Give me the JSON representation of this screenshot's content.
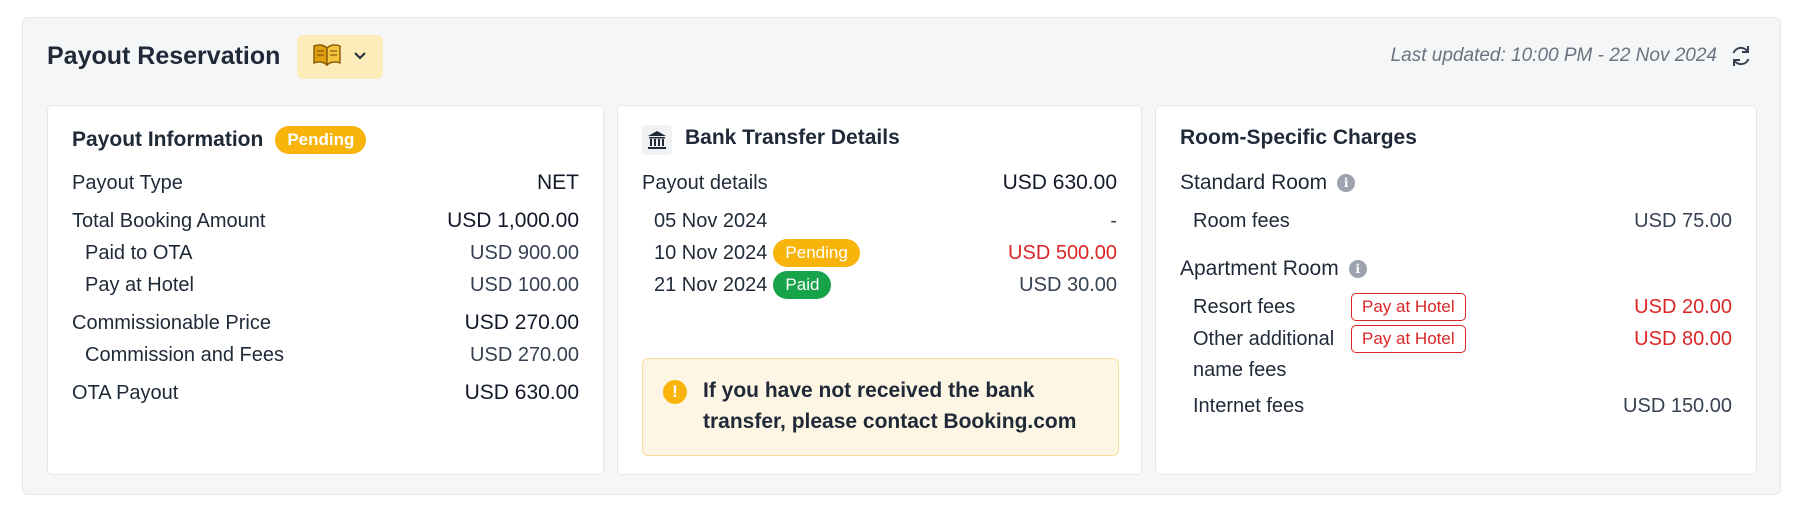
{
  "header": {
    "title": "Payout Reservation",
    "book_icon": "open-book-icon",
    "dropdown_icon": "chevron-down-icon",
    "last_updated": "Last updated: 10:00 PM - 22 Nov 2024",
    "refresh_icon": "refresh-icon"
  },
  "payout_info": {
    "title": "Payout Information",
    "status": "Pending",
    "rows": [
      {
        "label": "Payout Type",
        "value": "NET"
      },
      {
        "label": "Total Booking Amount",
        "value": "USD 1,000.00"
      },
      {
        "label": "Paid to OTA",
        "value": "USD 900.00"
      },
      {
        "label": "Pay at Hotel",
        "value": "USD 100.00"
      },
      {
        "label": "Commissionable Price",
        "value": "USD 270.00"
      },
      {
        "label": "Commission and Fees",
        "value": "USD 270.00"
      },
      {
        "label": "OTA Payout",
        "value": "USD 630.00"
      }
    ]
  },
  "bank": {
    "title": "Bank Transfer Details",
    "icon": "bank-icon",
    "summary": {
      "label": "Payout details",
      "value": "USD 630.00"
    },
    "transfers": [
      {
        "date": "05 Nov 2024",
        "status": "",
        "value": "-"
      },
      {
        "date": "10 Nov 2024",
        "status": "Pending",
        "value": "USD 500.00"
      },
      {
        "date": "21 Nov 2024",
        "status": "Paid",
        "value": "USD 30.00"
      }
    ],
    "alert": "If you have not received the bank transfer, please contact Booking.com",
    "alert_icon": "exclamation-icon"
  },
  "room_charges": {
    "title": "Room-Specific Charges",
    "rooms": [
      {
        "name": "Standard Room",
        "fees": [
          {
            "label": "Room fees",
            "tag": "",
            "value": "USD 75.00"
          }
        ]
      },
      {
        "name": "Apartment Room",
        "fees": [
          {
            "label": "Resort fees",
            "tag": "Pay at Hotel",
            "value": "USD 20.00"
          },
          {
            "label": "Other additional name fees",
            "tag": "Pay at Hotel",
            "value": "USD 80.00"
          },
          {
            "label": "Internet fees",
            "tag": "",
            "value": "USD 150.00"
          }
        ]
      }
    ]
  },
  "colors": {
    "pending": "#f8b40b",
    "paid": "#16a34a",
    "danger": "#dc2626",
    "alert_bg": "#fef6e4"
  }
}
